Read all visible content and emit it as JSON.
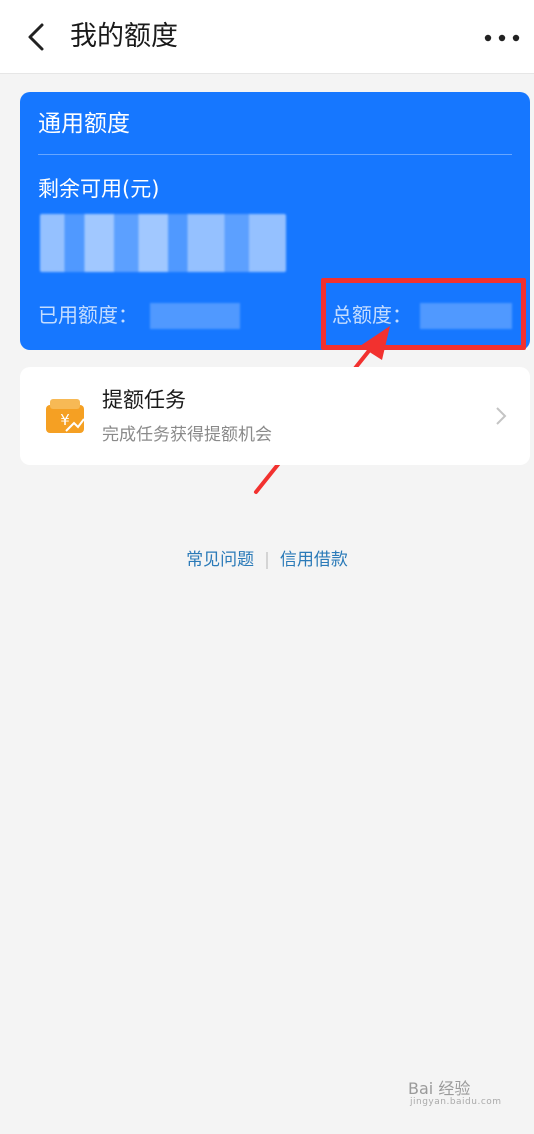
{
  "header": {
    "title": "我的额度"
  },
  "card": {
    "title": "通用额度",
    "remaining_label": "剩余可用(元)",
    "used_label": "已用额度：",
    "total_label": "总额度："
  },
  "task": {
    "title": "提额任务",
    "subtitle": "完成任务获得提额机会"
  },
  "links": {
    "faq": "常见问题",
    "separator": "|",
    "credit_loan": "信用借款"
  },
  "watermark": {
    "text": "Bai 经验",
    "sub": "jingyan.baidu.com"
  },
  "colors": {
    "card_blue": "#1677ff",
    "highlight_red": "#f2312f",
    "link_blue": "#2a7ab8",
    "task_icon_orange": "#f5a023"
  }
}
